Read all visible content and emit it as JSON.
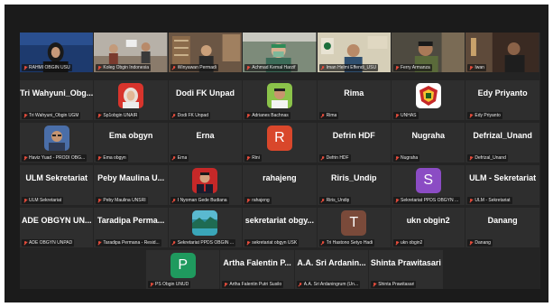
{
  "accent_color": "#27d44a",
  "mic_muted_color": "#e74c3c",
  "participants": [
    {
      "name": "",
      "label": "RAHMI OBGIN USU",
      "type": "video",
      "scene": "rahmi",
      "active": false
    },
    {
      "name": "",
      "label": "Koleg Obgin Indonesia",
      "type": "video",
      "scene": "koleg",
      "active": false
    },
    {
      "name": "",
      "label": "Winyawan Permadi",
      "type": "video",
      "scene": "winyawan",
      "active": false
    },
    {
      "name": "",
      "label": "Achmad Kemal Harzif",
      "type": "video",
      "scene": "kemal",
      "active": false
    },
    {
      "name": "",
      "label": "Iman Helmi Effendi_USU",
      "type": "video",
      "scene": "iman",
      "active": false
    },
    {
      "name": "",
      "label": "Ferry Armanza",
      "type": "video",
      "scene": "ferry",
      "active": true
    },
    {
      "name": "",
      "label": "Iwan",
      "type": "video",
      "scene": "iwan",
      "active": false
    },
    {
      "name": "Tri Wahyuni_Obg...",
      "label": "Tri Wahyuni_Obgin UGM",
      "type": "name"
    },
    {
      "name": "",
      "label": "Sp1obgin UNAIR",
      "type": "avatar",
      "avatar": "photo-hijab"
    },
    {
      "name": "Dodi FK Unpad",
      "label": "Dodi FK Unpad",
      "type": "name"
    },
    {
      "name": "",
      "label": "Adrianes Bachnas",
      "type": "avatar",
      "avatar": "photo-man-green"
    },
    {
      "name": "Rima",
      "label": "Rima",
      "type": "name"
    },
    {
      "name": "",
      "label": "UNHAS",
      "type": "avatar",
      "avatar": "logo-unhas"
    },
    {
      "name": "Edy Priyanto",
      "label": "Edy Priyanto",
      "type": "name"
    },
    {
      "name": "",
      "label": "Haviz Yuad - PRODI OBG...",
      "type": "avatar",
      "avatar": "photo-man-glasses"
    },
    {
      "name": "Ema obgyn",
      "label": "Ema obgyn",
      "type": "name"
    },
    {
      "name": "Erna",
      "label": "Erna",
      "type": "name"
    },
    {
      "name": "",
      "label": "Rini",
      "type": "avatar",
      "avatar": "letter",
      "letter": "R",
      "color": "#d9472b"
    },
    {
      "name": "Defrin HDF",
      "label": "Defrin HDF",
      "type": "name"
    },
    {
      "name": "Nugraha",
      "label": "Nugraha",
      "type": "name"
    },
    {
      "name": "Defrizal_Unand",
      "label": "Defrizal_Unand",
      "type": "name"
    },
    {
      "name": "ULM Sekretariat",
      "label": "ULM Sekretariat",
      "type": "name"
    },
    {
      "name": "Peby Maulina U...",
      "label": "Peby Maulina UNSRI",
      "type": "name"
    },
    {
      "name": "",
      "label": "I Nyoman Gede Budiana",
      "type": "avatar",
      "avatar": "photo-man-suit"
    },
    {
      "name": "rahajeng",
      "label": "rahajeng",
      "type": "name"
    },
    {
      "name": "Riris_Undip",
      "label": "Riris_Undip",
      "type": "name"
    },
    {
      "name": "",
      "label": "Sekretariat PPDS OBGYN ...",
      "type": "avatar",
      "avatar": "letter",
      "letter": "S",
      "color": "#8b4cc4"
    },
    {
      "name": "ULM - Sekretariat",
      "label": "ULM - Sekretariat",
      "type": "name"
    },
    {
      "name": "ADE OBGYN UN...",
      "label": "ADE OBGYN UNPAD",
      "type": "name"
    },
    {
      "name": "Taradipa Perma...",
      "label": "Taradipa Permana - Resid...",
      "type": "name"
    },
    {
      "name": "",
      "label": "Sekretariat PPDS OBGIN ...",
      "type": "avatar",
      "avatar": "photo-landscape"
    },
    {
      "name": "sekretariat obgy...",
      "label": "sekretariat obgyn USK",
      "type": "name"
    },
    {
      "name": "",
      "label": "Tri Hastono Setyo Hadi",
      "type": "avatar",
      "avatar": "letter",
      "letter": "T",
      "color": "#7a4a3a"
    },
    {
      "name": "ukn obgin2",
      "label": "ukn obgin2",
      "type": "name"
    },
    {
      "name": "Danang",
      "label": "Danang",
      "type": "name"
    },
    {
      "name": "",
      "label": "PS Obgin UNUD",
      "type": "avatar",
      "avatar": "letter",
      "letter": "P",
      "color": "#1f9a5e"
    },
    {
      "name": "Artha Falentin P...",
      "label": "Artha Falentin Putri Susilo",
      "type": "name"
    },
    {
      "name": "A.A. Sri Ardanin...",
      "label": "A.A. Sri Ardaningrum (Un...",
      "type": "name"
    },
    {
      "name": "Shinta Prawitasari",
      "label": "Shinta Prawitasari",
      "type": "name"
    }
  ]
}
